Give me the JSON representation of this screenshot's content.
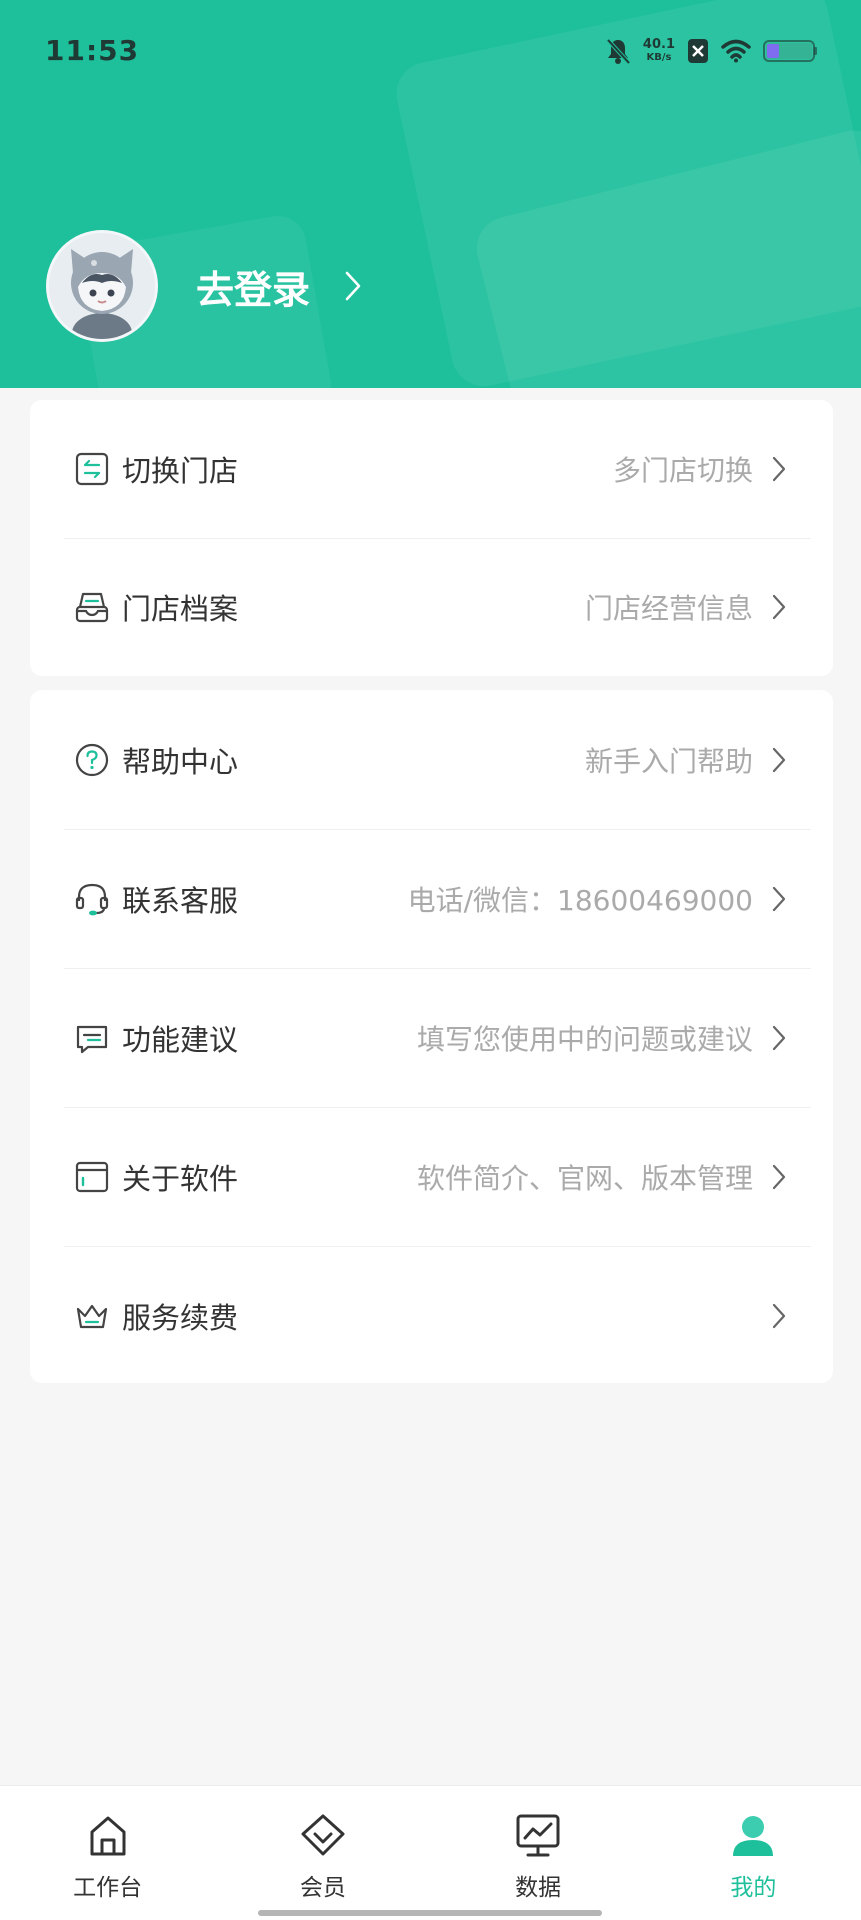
{
  "status_bar": {
    "time": "11:53",
    "net_speed_value": "40.1",
    "net_speed_unit": "KB/s",
    "icons": [
      "bell-mute-icon",
      "sim-off-icon",
      "wifi-icon",
      "battery-icon"
    ]
  },
  "profile": {
    "login_label": "去登录",
    "avatar_icon": "cat-hood-avatar"
  },
  "store_section": [
    {
      "icon": "switch-store-icon",
      "label": "切换门店",
      "sub": "多门店切换"
    },
    {
      "icon": "store-archive-icon",
      "label": "门店档案",
      "sub": "门店经营信息"
    }
  ],
  "support_section": [
    {
      "icon": "help-icon",
      "label": "帮助中心",
      "sub": "新手入门帮助"
    },
    {
      "icon": "headset-icon",
      "label": "联系客服",
      "sub": "电话/微信：18600469000"
    },
    {
      "icon": "feedback-icon",
      "label": "功能建议",
      "sub": "填写您使用中的问题或建议"
    },
    {
      "icon": "about-icon",
      "label": "关于软件",
      "sub": "软件简介、官网、版本管理"
    },
    {
      "icon": "crown-icon",
      "label": "服务续费",
      "sub": ""
    }
  ],
  "tabbar": [
    {
      "icon": "workbench-icon",
      "label": "工作台",
      "active": false
    },
    {
      "icon": "member-icon",
      "label": "会员",
      "active": false
    },
    {
      "icon": "data-icon",
      "label": "数据",
      "active": false
    },
    {
      "icon": "profile-icon",
      "label": "我的",
      "active": true
    }
  ],
  "colors": {
    "accent": "#1ec09c",
    "background": "#f6f6f6",
    "text_primary": "#333333",
    "text_secondary": "#aaaaaa"
  }
}
